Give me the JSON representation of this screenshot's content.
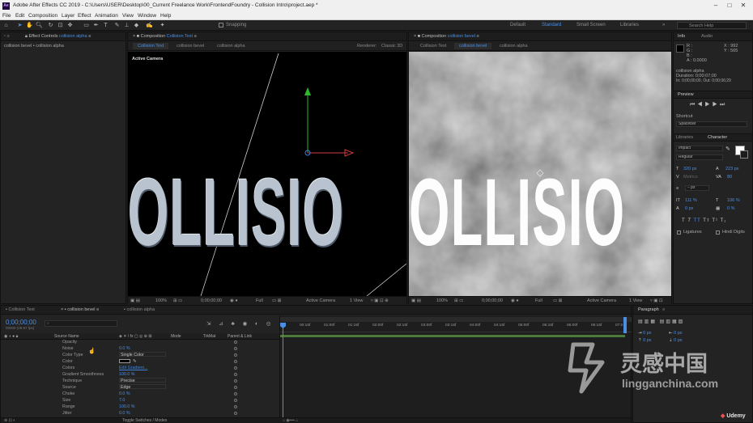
{
  "window": {
    "title": "Adobe After Effects CC 2019 - C:\\Users\\USER\\Desktop\\00_Current Freelance Work\\FrontendFoundry - Collision Intro\\project.aep *",
    "logo_text": "Ae",
    "search_placeholder": "Search Help"
  },
  "menu": [
    "File",
    "Edit",
    "Composition",
    "Layer",
    "Effect",
    "Animation",
    "View",
    "Window",
    "Help"
  ],
  "toolbar": {
    "snapping_label": "Snapping",
    "workspaces": [
      "Default",
      "Standard",
      "Small Screen",
      "Libraries"
    ],
    "active_workspace": "Standard"
  },
  "effect_controls": {
    "tab_prefix": "Effect Controls",
    "tab_layer": "collision alpha",
    "breadcrumb": "collision bevel • collision alpha"
  },
  "comp_left": {
    "tab_prefix": "Composition",
    "tab_name": "Collision Text",
    "subtabs": [
      "Collision Text",
      "collision bevel",
      "collision alpha"
    ],
    "renderer_label": "Renderer:",
    "renderer_value": "Classic 3D",
    "camera_label": "Active Camera",
    "big_text": "OLLISIO",
    "footer": {
      "zoom": "100%",
      "timecode": "0;00;00;00",
      "quality": "Full",
      "camera": "Active Camera",
      "views": "1 View"
    }
  },
  "comp_right": {
    "tab_prefix": "Composition",
    "tab_name": "collision bevel",
    "subtabs": [
      "Collision Text",
      "collision bevel",
      "collision alpha"
    ],
    "big_text": "OLLISIO",
    "footer": {
      "zoom": "100%",
      "timecode": "0;00;00;00",
      "quality": "Full",
      "camera": "Active Camera",
      "views": "1 View"
    }
  },
  "info": {
    "tabs": [
      "Info",
      "Audio"
    ],
    "r": "R :",
    "g": "G :",
    "b": "B :",
    "a": "A : 0.0000",
    "x": "X : 992",
    "y": "Y : 565",
    "lines": [
      "collision alpha",
      "Duration: 0;00;07;00",
      "In: 0;00;00;00, Out: 0;00;06;29"
    ]
  },
  "preview": {
    "title": "Preview"
  },
  "shortcut": {
    "label": "Shortcut",
    "value": "Spacebar"
  },
  "character": {
    "tabs": [
      "Libraries",
      "Character"
    ],
    "font": "Impact",
    "style": "Regular",
    "size": "320 px",
    "leading": "223 px",
    "kerning": "Metrics",
    "tracking": "80",
    "stroke_width": "– px",
    "vscale": "111 %",
    "hscale": "106 %",
    "baseline": "0 px",
    "tsume": "0 %",
    "style_buttons": [
      "T",
      "T",
      "TT",
      "Tт",
      "T¹",
      "T₁"
    ],
    "ligatures": "Ligatures",
    "hindi_digits": "Hindi Digits"
  },
  "paragraph": {
    "title": "Paragraph",
    "indent": "0 px"
  },
  "timeline": {
    "tabs": [
      "Collision Text",
      "collision bevel",
      "collision alpha"
    ],
    "active_tab": "collision bevel",
    "timecode": "0;00;00;00",
    "frame_info": "00000 (29.97 fps)",
    "col_source": "Source Name",
    "col_mode": "Mode",
    "col_trkmat": "TrkMat",
    "col_parent": "Parent & Link",
    "rows": [
      {
        "name": "Opacity",
        "value": ""
      },
      {
        "name": "Noise",
        "value": "0.0 %"
      },
      {
        "name": "Color Type",
        "value": "Single Color"
      },
      {
        "name": "Color",
        "value": ""
      },
      {
        "name": "Colors",
        "value": "Edit Gradient..."
      },
      {
        "name": "Gradient Smoothness",
        "value": "100.0 %"
      },
      {
        "name": "Technique",
        "value": "Precise"
      },
      {
        "name": "Source",
        "value": "Edge"
      },
      {
        "name": "Choke",
        "value": "0.0 %"
      },
      {
        "name": "Size",
        "value": "7.0"
      },
      {
        "name": "Range",
        "value": "100.0 %"
      },
      {
        "name": "Jitter",
        "value": "0.0 %"
      }
    ],
    "ruler": [
      "00:15f",
      "01:00f",
      "01:15f",
      "02:00f",
      "02:15f",
      "03:00f",
      "03:15f",
      "04:00f",
      "04:15f",
      "05:00f",
      "05:15f",
      "06:00f",
      "06:15f",
      "07:0"
    ],
    "toggle_label": "Toggle Switches / Modes"
  },
  "watermark": {
    "cn": "灵感中国",
    "url": "lingganchina.com",
    "udemy": "Udemy"
  },
  "colors": {
    "accent": "#4a8fe6",
    "link": "#3b82d9",
    "playhead": "#4a8fe6",
    "timeline_bar": "#4a7a3a"
  }
}
